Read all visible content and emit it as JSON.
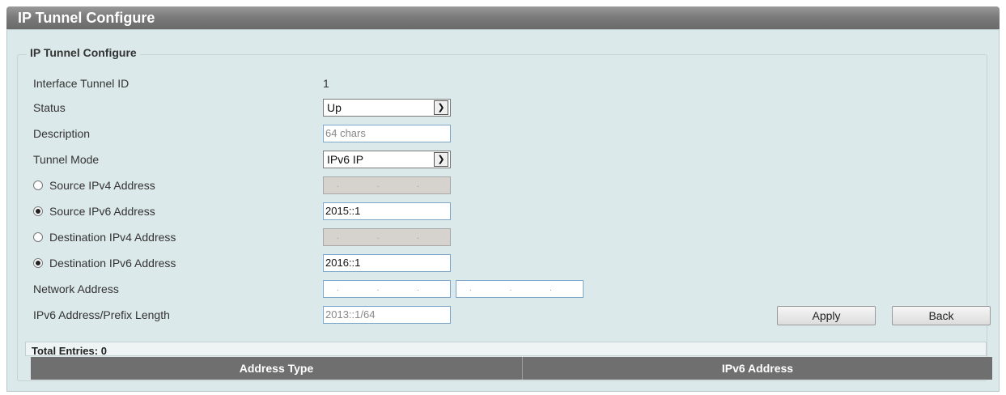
{
  "page": {
    "title": "IP Tunnel Configure",
    "section_legend": "IP Tunnel Configure"
  },
  "form": {
    "interface_tunnel_id": {
      "label": "Interface Tunnel ID",
      "value": "1"
    },
    "status": {
      "label": "Status",
      "value": "Up"
    },
    "description": {
      "label": "Description",
      "placeholder": "64 chars"
    },
    "tunnel_mode": {
      "label": "Tunnel Mode",
      "value": "IPv6 IP"
    },
    "source_ipv4": {
      "label": "Source IPv4 Address",
      "selected": false,
      "value": ". . ."
    },
    "source_ipv6": {
      "label": "Source IPv6 Address",
      "selected": true,
      "value": "2015::1"
    },
    "destination_ipv4": {
      "label": "Destination IPv4 Address",
      "selected": false,
      "value": ". . ."
    },
    "destination_ipv6": {
      "label": "Destination IPv6 Address",
      "selected": true,
      "value": "2016::1"
    },
    "network_address": {
      "label": "Network Address",
      "address_value": ". . .",
      "mask_value": ". . ."
    },
    "ipv6_prefix": {
      "label": "IPv6 Address/Prefix Length",
      "placeholder": "2013::1/64"
    }
  },
  "buttons": {
    "apply": "Apply",
    "back": "Back"
  },
  "table": {
    "total_entries": "Total Entries: 0",
    "columns": [
      "Address Type",
      "IPv6 Address"
    ]
  },
  "colors": {
    "panel_background": "#dce9ea",
    "title_bar": "#7b7b7b",
    "table_header": "#6f6f6f"
  }
}
